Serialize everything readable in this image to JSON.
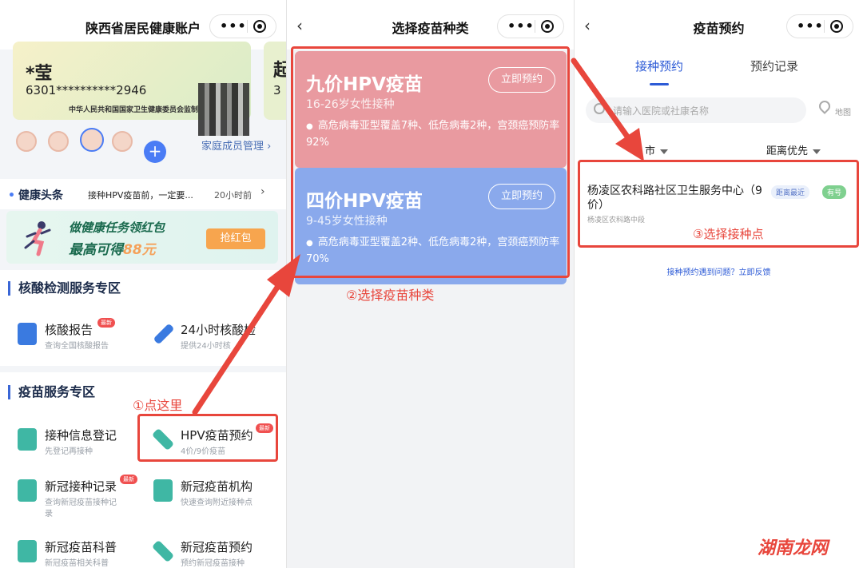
{
  "panel1": {
    "title": "陕西省居民健康账户",
    "card": {
      "name": "*莹",
      "id_number": "6301**********2946",
      "issuer": "中华人民共和国国家卫生健康委员会监制",
      "next_card_char": "起",
      "next_card_digit": "3"
    },
    "family_manage": "家庭成员管理",
    "news_label": "健康头条",
    "news_text": "接种HPV疫苗前，一定要...",
    "news_time": "20小时前",
    "banner": {
      "line1": "做健康任务领红包",
      "line2_prefix": "最高可得",
      "line2_amount": "88元",
      "button": "抢红包"
    },
    "nucleic": {
      "title": "核酸检测服务专区",
      "items": [
        {
          "label": "核酸报告",
          "sub": "查询全国核酸报告",
          "badge": "最新"
        },
        {
          "label": "24小时核酸检",
          "sub": "提供24小时核"
        }
      ]
    },
    "vaccine": {
      "title": "疫苗服务专区",
      "items": [
        {
          "label": "接种信息登记",
          "sub": "先登记再接种"
        },
        {
          "label": "HPV疫苗预约",
          "sub": "4价/9价疫苗",
          "badge": "最新"
        },
        {
          "label": "新冠接种记录",
          "sub": "查询新冠疫苗接种记",
          "sub2": "录",
          "badge": "最新"
        },
        {
          "label": "新冠疫苗机构",
          "sub": "快速查询附近接种点"
        },
        {
          "label": "新冠疫苗科普",
          "sub": "新冠疫苗相关科普"
        },
        {
          "label": "新冠疫苗预约",
          "sub": "预约新冠疫苗接种"
        }
      ]
    },
    "annotation": "①点这里"
  },
  "panel2": {
    "title": "选择疫苗种类",
    "cards": [
      {
        "name": "九价HPV疫苗",
        "age": "16-26岁女性接种",
        "desc": "高危病毒亚型覆盖7种、低危病毒2种，宫颈癌预防率92%",
        "button": "立即预约"
      },
      {
        "name": "四价HPV疫苗",
        "age": "9-45岁女性接种",
        "desc": "高危病毒亚型覆盖2种、低危病毒2种，宫颈癌预防率70%",
        "button": "立即预约"
      }
    ],
    "annotation": "②选择疫苗种类"
  },
  "panel3": {
    "title": "疫苗预约",
    "tabs": [
      "接种预约",
      "预约记录"
    ],
    "search_placeholder": "请输入医院或社康名称",
    "map_label": "地图",
    "filter_city": "市",
    "filter_sort": "距离优先",
    "hospital": {
      "name": "杨凌区农科路社区卫生服务中心（9价）",
      "address": "杨凌区农科路中段",
      "badge_distance": "距离最近",
      "badge_status": "有号"
    },
    "feedback": "接种预约遇到问题？立即反馈",
    "annotation": "③选择接种点"
  },
  "watermark": "湖南龙网",
  "colors": {
    "annotation_red": "#e8463c",
    "nine_valent_pink": "#e99aa0",
    "four_valent_blue": "#8aa9ec",
    "accent_blue": "#2d5bd6"
  }
}
